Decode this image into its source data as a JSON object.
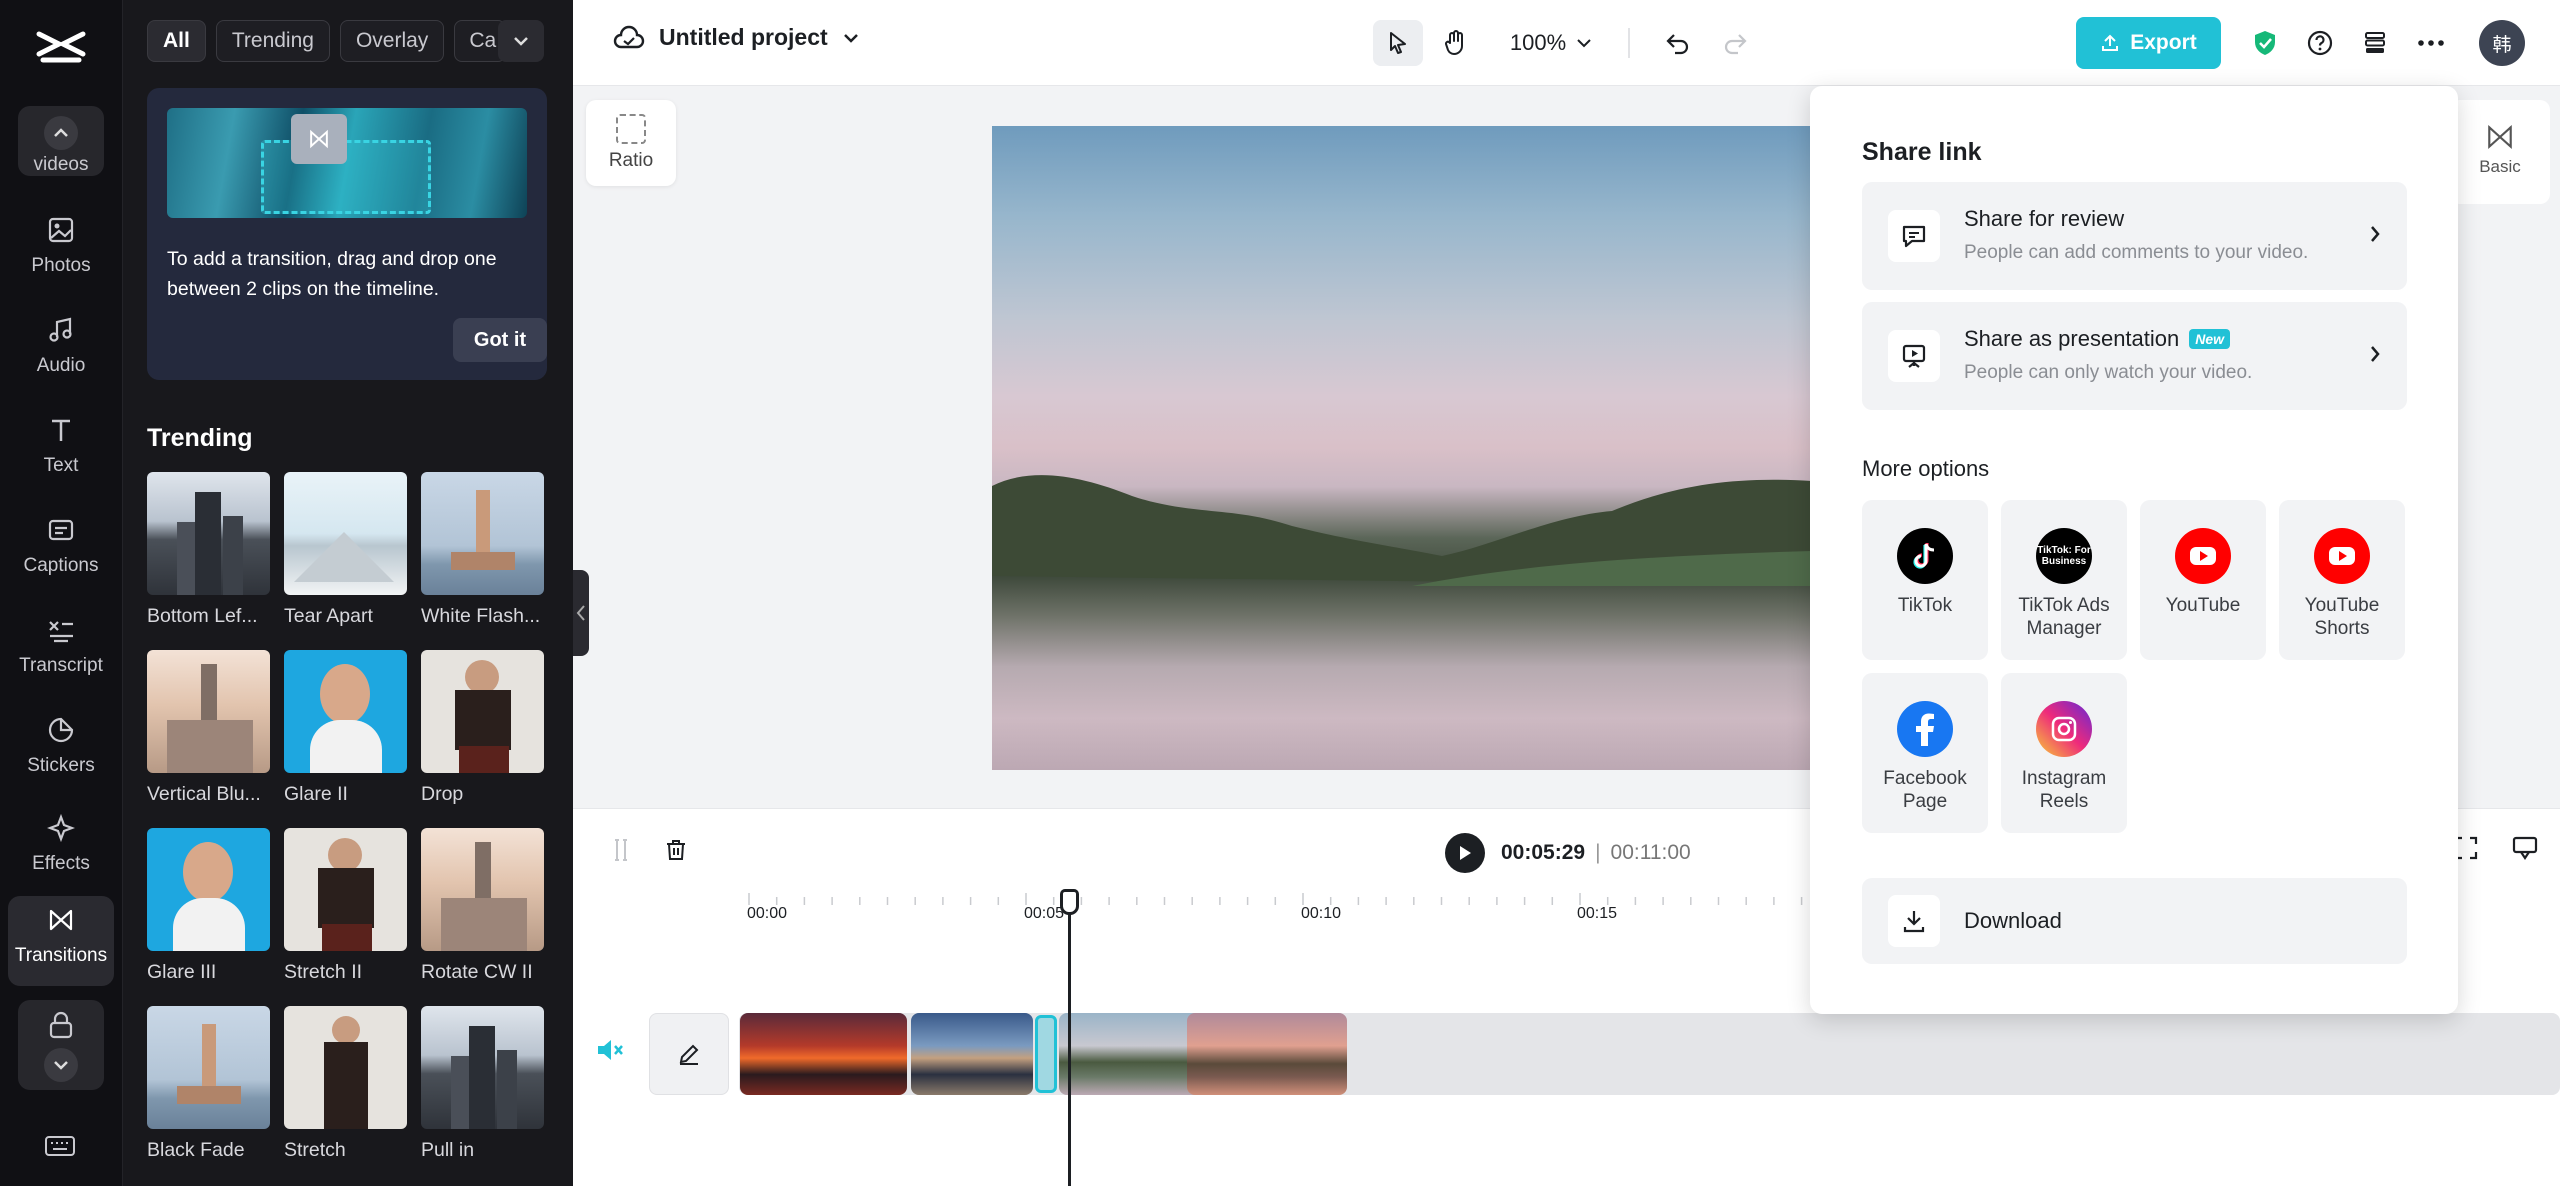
{
  "project": {
    "title": "Untitled project"
  },
  "toolbar": {
    "zoom": "100%",
    "export_label": "Export",
    "avatar_initial": "韩"
  },
  "rail": {
    "scroll_label": "videos",
    "items": [
      {
        "label": "Photos",
        "icon": "photo-icon"
      },
      {
        "label": "Audio",
        "icon": "music-icon"
      },
      {
        "label": "Text",
        "icon": "text-icon"
      },
      {
        "label": "Captions",
        "icon": "captions-icon"
      },
      {
        "label": "Transcript",
        "icon": "transcript-icon"
      },
      {
        "label": "Stickers",
        "icon": "sticker-icon"
      },
      {
        "label": "Effects",
        "icon": "effects-icon"
      },
      {
        "label": "Transitions",
        "icon": "transition-icon"
      }
    ]
  },
  "panel": {
    "chips": [
      "All",
      "Trending",
      "Overlay",
      "Ca"
    ],
    "tip": {
      "text": "To add a transition, drag and drop one between 2 clips on the timeline.",
      "button": "Got it"
    },
    "section_title": "Trending",
    "tiles": [
      "Bottom Lef...",
      "Tear Apart",
      "White Flash...",
      "Vertical Blu...",
      "Glare II",
      "Drop",
      "Glare III",
      "Stretch II",
      "Rotate CW II",
      "Black Fade",
      "Stretch",
      "Pull in"
    ]
  },
  "canvas": {
    "ratio_label": "Ratio",
    "basic_label": "Basic"
  },
  "timeline": {
    "current_time": "00:05:29",
    "separator": "|",
    "total_time": "00:11:00",
    "ruler": [
      "00:00",
      "00:05",
      "00:10",
      "00:15"
    ]
  },
  "share": {
    "title": "Share link",
    "review": {
      "title": "Share for review",
      "subtitle": "People can add comments to your video."
    },
    "presentation": {
      "title": "Share as presentation",
      "badge": "New",
      "subtitle": "People can only watch your video."
    },
    "more_title": "More options",
    "platforms": [
      "TikTok",
      "TikTok Ads Manager",
      "YouTube",
      "YouTube Shorts",
      "Facebook Page",
      "Instagram Reels"
    ],
    "tiktok_ads_logo_text": "TikTok: For Business",
    "download_label": "Download"
  },
  "colors": {
    "accent": "#21c1d6",
    "rail_bg": "#101014",
    "panel_bg": "#18181c",
    "youtube": "#ff0000",
    "facebook": "#1877f2"
  }
}
